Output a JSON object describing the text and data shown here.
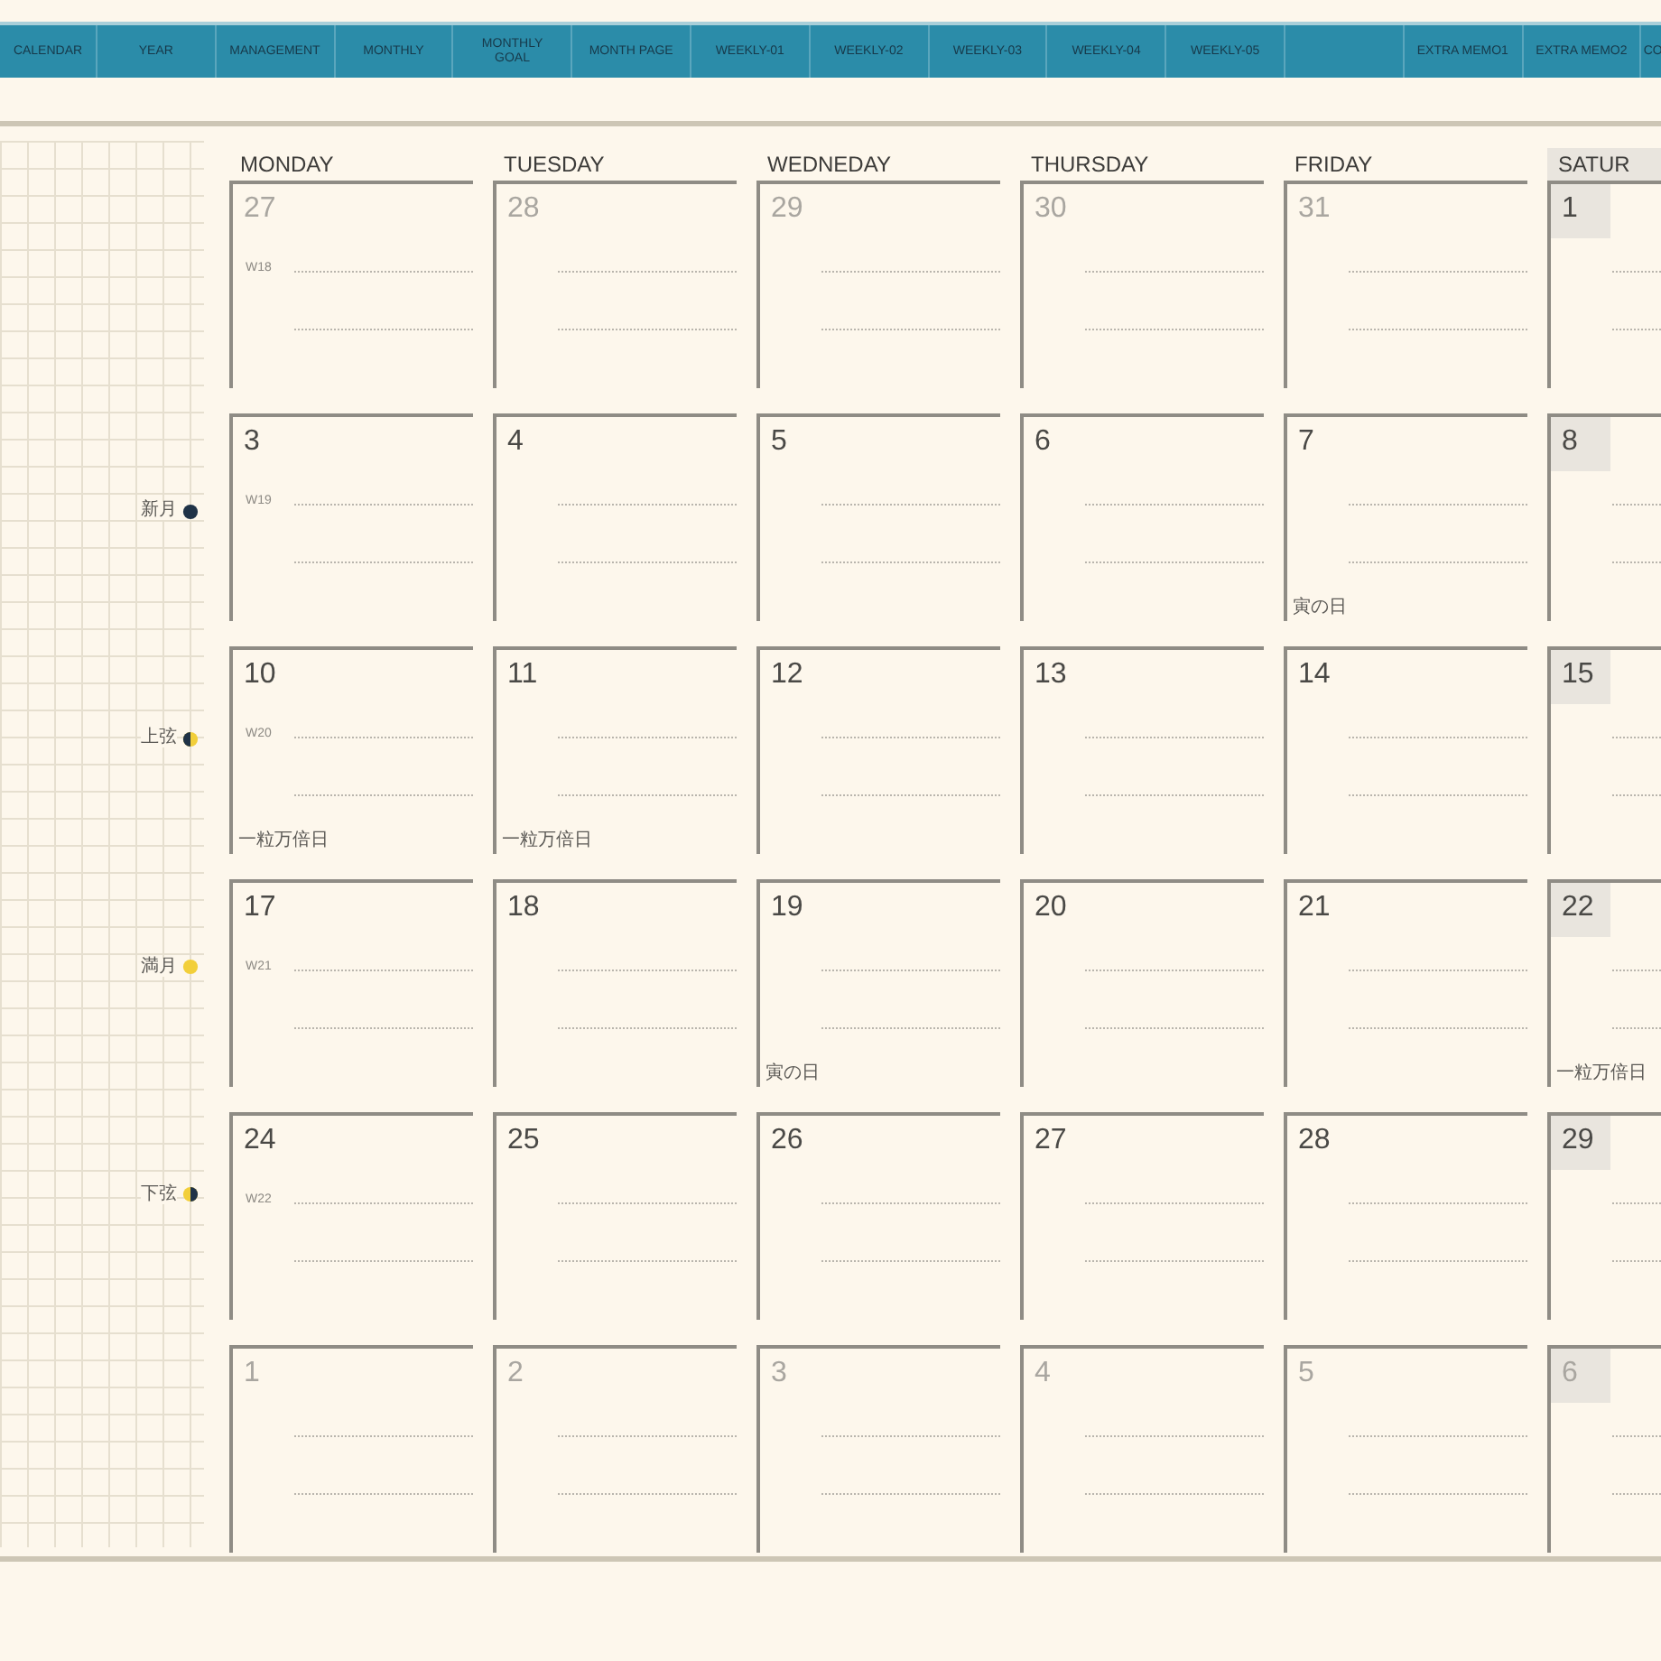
{
  "tabs": [
    {
      "label": "CALENDAR"
    },
    {
      "label": "YEAR"
    },
    {
      "label": "MANAGEMENT"
    },
    {
      "label": "MONTHLY"
    },
    {
      "label": "MONTHLY GOAL"
    },
    {
      "label": "MONTH PAGE"
    },
    {
      "label": "WEEKLY-01"
    },
    {
      "label": "WEEKLY-02"
    },
    {
      "label": "WEEKLY-03"
    },
    {
      "label": "WEEKLY-04"
    },
    {
      "label": "WEEKLY-05"
    }
  ],
  "extra_tabs": [
    {
      "label": "EXTRA MEMO1"
    },
    {
      "label": "EXTRA MEMO2"
    },
    {
      "label": "CO"
    }
  ],
  "columns": [
    {
      "label": "MONDAY",
      "shaded": false
    },
    {
      "label": "TUESDAY",
      "shaded": false
    },
    {
      "label": "WEDNEDAY",
      "shaded": false
    },
    {
      "label": "THURSDAY",
      "shaded": false
    },
    {
      "label": "FRIDAY",
      "shaded": false
    },
    {
      "label": "SATUR",
      "shaded": true
    }
  ],
  "weeks": [
    {
      "week": "W18",
      "days": [
        {
          "day": "27",
          "muted": true
        },
        {
          "day": "28",
          "muted": true
        },
        {
          "day": "29",
          "muted": true
        },
        {
          "day": "30",
          "muted": true
        },
        {
          "day": "31",
          "muted": true
        },
        {
          "day": "1",
          "muted": false
        }
      ]
    },
    {
      "week": "W19",
      "moon": {
        "label": "新月",
        "kind": "new"
      },
      "days": [
        {
          "day": "3",
          "muted": false
        },
        {
          "day": "4",
          "muted": false
        },
        {
          "day": "5",
          "muted": false
        },
        {
          "day": "6",
          "muted": false
        },
        {
          "day": "7",
          "muted": false,
          "note": "寅の日"
        },
        {
          "day": "8",
          "muted": false
        }
      ]
    },
    {
      "week": "W20",
      "moon": {
        "label": "上弦",
        "kind": "first_quarter"
      },
      "days": [
        {
          "day": "10",
          "muted": false,
          "note": "一粒万倍日"
        },
        {
          "day": "11",
          "muted": false,
          "note": "一粒万倍日"
        },
        {
          "day": "12",
          "muted": false
        },
        {
          "day": "13",
          "muted": false
        },
        {
          "day": "14",
          "muted": false
        },
        {
          "day": "15",
          "muted": false
        }
      ]
    },
    {
      "week": "W21",
      "moon": {
        "label": "満月",
        "kind": "full"
      },
      "days": [
        {
          "day": "17",
          "muted": false
        },
        {
          "day": "18",
          "muted": false
        },
        {
          "day": "19",
          "muted": false,
          "note": "寅の日"
        },
        {
          "day": "20",
          "muted": false
        },
        {
          "day": "21",
          "muted": false
        },
        {
          "day": "22",
          "muted": false,
          "note": "一粒万倍日"
        }
      ]
    },
    {
      "week": "W22",
      "moon": {
        "label": "下弦",
        "kind": "last_quarter"
      },
      "days": [
        {
          "day": "24",
          "muted": false
        },
        {
          "day": "25",
          "muted": false
        },
        {
          "day": "26",
          "muted": false
        },
        {
          "day": "27",
          "muted": false
        },
        {
          "day": "28",
          "muted": false
        },
        {
          "day": "29",
          "muted": false
        }
      ]
    },
    {
      "days": [
        {
          "day": "1",
          "muted": true
        },
        {
          "day": "2",
          "muted": true
        },
        {
          "day": "3",
          "muted": true
        },
        {
          "day": "4",
          "muted": true
        },
        {
          "day": "5",
          "muted": true
        },
        {
          "day": "6",
          "muted": true
        }
      ]
    }
  ]
}
